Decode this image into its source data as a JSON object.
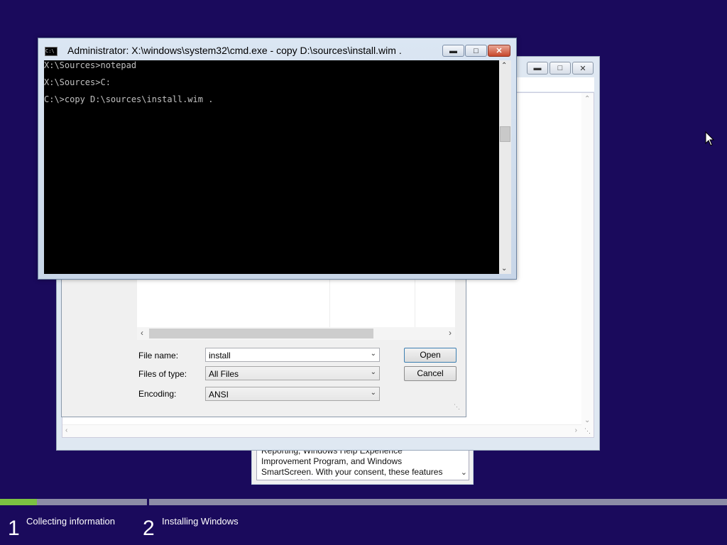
{
  "cmd_window": {
    "title": "Administrator: X:\\windows\\system32\\cmd.exe - copy  D:\\sources\\install.wim .",
    "lines": [
      "X:\\Sources>notepad",
      "X:\\Sources>C:",
      "C:\\>copy D:\\sources\\install.wim ."
    ]
  },
  "open_dialog": {
    "file_name_label": "File name:",
    "file_name_value": "install",
    "files_of_type_label": "Files of type:",
    "files_of_type_value": "All Files",
    "encoding_label": "Encoding:",
    "encoding_value": "ANSI",
    "open_label": "Open",
    "cancel_label": "Cancel"
  },
  "setup_window": {
    "license_text": "Reporting, Windows Help Experience Improvement Program, and Windows SmartScreen. With your consent, these features may send information over"
  },
  "progress": {
    "fraction": 0.25,
    "steps": [
      {
        "number": "1",
        "label": "Collecting information"
      },
      {
        "number": "2",
        "label": "Installing Windows"
      }
    ]
  },
  "colors": {
    "desktop": "#1a0a5c",
    "progress_fill": "#7bc242"
  },
  "icons": [
    "cmd-icon",
    "minimize-icon",
    "maximize-icon",
    "close-icon",
    "chevron-down-icon",
    "chevron-left-icon",
    "chevron-right-icon",
    "mouse-cursor-icon"
  ]
}
